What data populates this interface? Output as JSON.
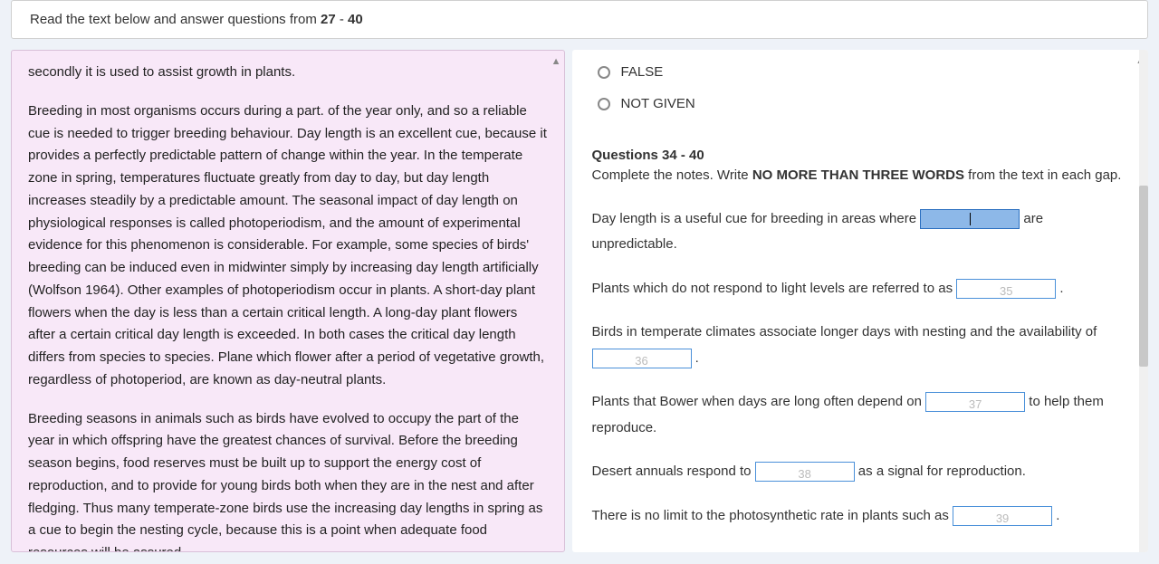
{
  "header": {
    "prefix": "Read the text below and answer questions from ",
    "from": "27",
    "dash": " - ",
    "to": "40"
  },
  "passage": {
    "p1": "secondly it is used to assist growth in plants.",
    "p2": "Breeding in most organisms occurs during a part. of the year only, and so a reliable cue is needed to trigger breeding behaviour. Day length is an excellent cue, because it provides a perfectly predictable pattern of change within the year. In the temperate zone in spring, temperatures fluctuate greatly from day to day, but day length increases steadily by a predictable amount. The seasonal impact of day length on physiological responses is called photoperiodism, and the amount of experimental evidence for this phenomenon is considerable. For example, some species of birds' breeding can be induced even in midwinter simply by increasing day length artificially (Wolfson 1964). Other examples of photoperiodism occur in plants. A short-day plant flowers when the day is less than a certain critical length. A long-day plant flowers after a certain critical day length is exceeded. In both cases the critical day length differs from species to species. Plane which flower after a period of vegetative growth, regardless of photoperiod, are known as day-neutral plants.",
    "p3": "Breeding seasons in animals such as birds have evolved to occupy the part of the year in which offspring have the greatest chances of survival. Before the breeding season begins, food reserves must be built up to support the energy cost of reproduction, and to provide for young birds both when they are in the nest and after fledging. Thus many temperate-zone birds use the increasing day lengths in spring as a cue to begin the nesting cycle, because this is a point when adequate food resources will be assured."
  },
  "radio_options": {
    "false": "FALSE",
    "not_given": "NOT GIVEN"
  },
  "section": {
    "heading": "Questions 34 - 40",
    "instruct_pre": "Complete the notes. Write ",
    "instruct_bold": "NO MORE THAN THREE WORDS",
    "instruct_post": " from the text in each gap."
  },
  "gaps": {
    "g34_pre": "Day length is a useful cue for breeding in areas where ",
    "g34_num": "",
    "g34_post": " are unpredictable.",
    "g35_pre": "Plants which do not respond to light levels are referred to as ",
    "g35_num": "35",
    "g35_post": " .",
    "g36_pre": "Birds in temperate climates associate longer days with nesting and the availability of ",
    "g36_num": "36",
    "g36_post": " .",
    "g37_pre": "Plants that Bower when days are long often depend on ",
    "g37_num": "37",
    "g37_post": " to help them reproduce.",
    "g38_pre": "Desert annuals respond to ",
    "g38_num": "38",
    "g38_post": " as a signal for reproduction.",
    "g39_pre": "There is no limit to the photosynthetic rate in plants such as ",
    "g39_num": "39",
    "g39_post": " ."
  }
}
